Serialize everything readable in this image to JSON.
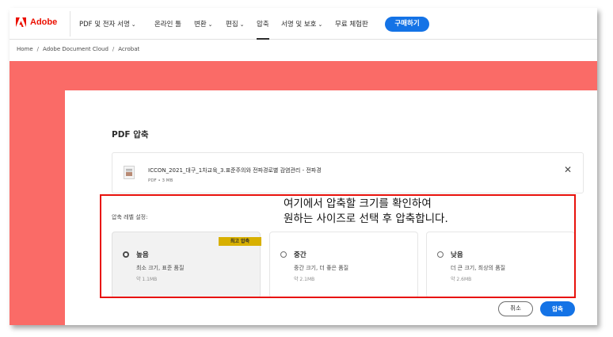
{
  "nav": {
    "brand": "Adobe",
    "items": [
      {
        "label": "PDF 및 전자 서명",
        "dropdown": true
      },
      {
        "label": "온라인 툴",
        "dropdown": false
      },
      {
        "label": "변환",
        "dropdown": true
      },
      {
        "label": "편집",
        "dropdown": true
      },
      {
        "label": "압축",
        "dropdown": false,
        "active": true
      },
      {
        "label": "서명 및 보호",
        "dropdown": true
      },
      {
        "label": "무료 체험판",
        "dropdown": false
      }
    ],
    "buy_label": "구매하기"
  },
  "breadcrumb": [
    "Home",
    "Adobe Document Cloud",
    "Acrobat"
  ],
  "card": {
    "title": "PDF 압축",
    "file": {
      "name": "ICCON_2021_대구_1차교육_3.표준주의와 전파경로별 감염관리 - 전파경",
      "meta": "PDF • 3 MB"
    },
    "level_label": "압축 레벨 설정:",
    "options": [
      {
        "title": "높음",
        "desc": "최소 크기, 표준 품질",
        "size": "약 1.1MB",
        "badge": "최고 압축",
        "selected": true
      },
      {
        "title": "중간",
        "desc": "중간 크기, 더 좋은 품질",
        "size": "약 2.1MB",
        "selected": false
      },
      {
        "title": "낮음",
        "desc": "더 큰 크기, 최상의 품질",
        "size": "약 2.6MB",
        "selected": false
      }
    ],
    "cancel_label": "취소",
    "compress_label": "압축"
  },
  "annotation": {
    "line1": "여기에서 압축할 크기를 확인하여",
    "line2": "원하는 사이즈로 선택 후 압축합니다."
  },
  "colors": {
    "accent": "#1473e6",
    "brand": "#eb1000",
    "band": "#fa6b67",
    "badge": "#d8b000",
    "annotation": "#e8120c"
  }
}
